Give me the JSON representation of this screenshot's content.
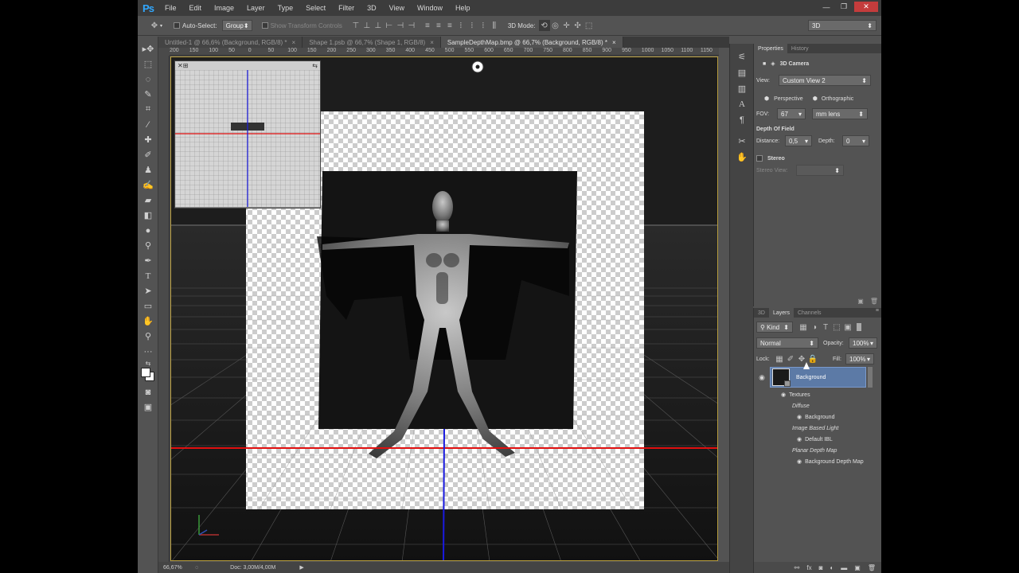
{
  "app": {
    "logo": "Ps"
  },
  "menu": [
    "File",
    "Edit",
    "Image",
    "Layer",
    "Type",
    "Select",
    "Filter",
    "3D",
    "View",
    "Window",
    "Help"
  ],
  "options": {
    "auto_select_label": "Auto-Select:",
    "auto_select_value": "Group",
    "show_transform_label": "Show Transform Controls",
    "mode_3d_label": "3D Mode:",
    "workspace": "3D"
  },
  "tabs": [
    {
      "label": "Untitled-1 @ 66,6% (Background, RGB/8) *",
      "close": "×"
    },
    {
      "label": "Shape 1.psb @ 66,7% (Shape 1, RGB/8)",
      "close": "×"
    },
    {
      "label": "SampleDepthMap.bmp @ 66,7% (Background, RGB/8) *",
      "close": "×"
    }
  ],
  "ruler_ticks": [
    "200",
    "150",
    "100",
    "50",
    "0",
    "50",
    "100",
    "150",
    "200",
    "250",
    "300",
    "350",
    "400",
    "450",
    "500",
    "550",
    "600",
    "650",
    "700",
    "750",
    "800",
    "850",
    "900",
    "950",
    "1000",
    "1050",
    "1100",
    "1150",
    "12"
  ],
  "status": {
    "zoom": "66,67%",
    "doc": "Doc: 3,00M/4,00M"
  },
  "properties": {
    "tabs": [
      "Properties",
      "History"
    ],
    "section": "3D Camera",
    "view_label": "View:",
    "view_value": "Custom View 2",
    "perspective": "Perspective",
    "orthographic": "Orthographic",
    "fov_label": "FOV:",
    "fov_value": "67",
    "lens_value": "mm lens",
    "dof_label": "Depth Of Field",
    "distance_label": "Distance:",
    "distance_value": "0,5",
    "depth_label": "Depth:",
    "depth_value": "0",
    "stereo_label": "Stereo",
    "stereo_view_label": "Stereo View:"
  },
  "layers": {
    "tabs": [
      "3D",
      "Layers",
      "Channels"
    ],
    "kind": "Kind",
    "blend": "Normal",
    "opacity_label": "Opacity:",
    "opacity_value": "100%",
    "lock_label": "Lock:",
    "fill_label": "Fill:",
    "fill_value": "100%",
    "layer_name": "Background",
    "textures": "Textures",
    "diffuse": "Diffuse",
    "diffuse_item": "Background",
    "ibl": "Image Based Light",
    "ibl_item": "Default IBL",
    "pdm": "Planar Depth Map",
    "pdm_item": "Background Depth Map"
  }
}
